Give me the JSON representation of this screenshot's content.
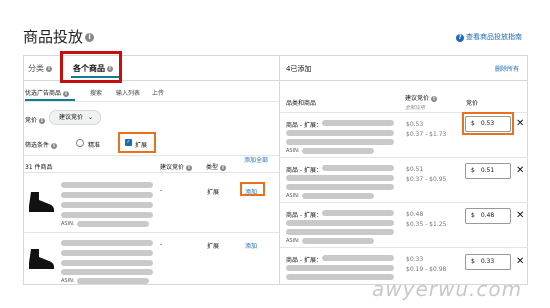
{
  "page": {
    "title": "商品投放",
    "guide_link": "查看商品投放指南"
  },
  "tabs": {
    "category": "分类",
    "individual": "各个商品"
  },
  "left": {
    "subtabs": [
      "优选广告商品",
      "搜索",
      "输入列表",
      "上传"
    ],
    "bid_label": "竞价",
    "bid_select": "建议竞价",
    "filter_label": "筛选条件",
    "filter_exact": "精准",
    "filter_expanded": "扩展",
    "count_label": "31 件商品",
    "col_suggested": "建议竞价",
    "col_type": "类型",
    "col_add_all": "添加全部",
    "rows": [
      {
        "asin": "ASIN:",
        "bid": "-",
        "type": "扩展",
        "add": "添加"
      },
      {
        "asin": "ASIN:",
        "bid": "-",
        "type": "扩展",
        "add": "添加"
      }
    ]
  },
  "right": {
    "added_header": "4已添加",
    "delete_all": "删除所有",
    "col_product": "品类和商品",
    "col_suggested": "建议竞价",
    "col_suggested_sub": "全部应用",
    "col_bid": "竞价",
    "rows": [
      {
        "name": "商品 - 扩展：",
        "asin": "ASIN:",
        "price": "$0.53",
        "range": "$0.37 - $1.73",
        "bid": "0.53"
      },
      {
        "name": "商品 - 扩展：",
        "asin": "ASIN:",
        "price": "$0.51",
        "range": "$0.37 - $0.95",
        "bid": "0.51"
      },
      {
        "name": "商品 - 扩展：",
        "asin": "ASIN:",
        "price": "$0.48",
        "range": "$0.35 - $1.25",
        "bid": "0.48"
      },
      {
        "name": "商品 - 扩展：",
        "asin": "ASIN:",
        "price": "$0.33",
        "range": "$0.19 - $0.98",
        "bid": "0.33"
      }
    ]
  },
  "currency": "$",
  "watermark": "awyerwu.com",
  "colors": {
    "accent": "#0f7c90",
    "link": "#1a6bb5",
    "highlight_red": "#c40f0f",
    "highlight_orange": "#e8711d"
  },
  "icons": [
    "info-icon",
    "shoe-icon",
    "close-icon",
    "chevron-down-icon",
    "checkbox-checked-icon",
    "radio-icon"
  ]
}
